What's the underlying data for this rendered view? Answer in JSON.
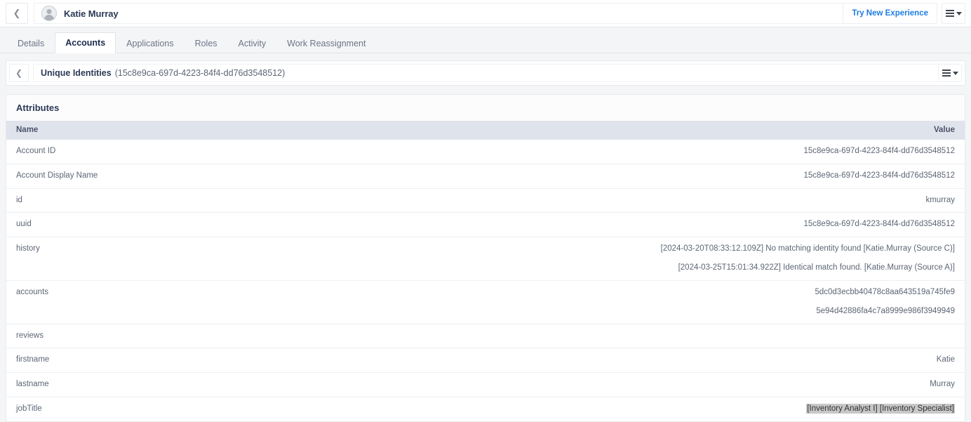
{
  "topbar": {
    "back_icon": "chevron-left-icon",
    "avatar_icon": "user-avatar-icon",
    "identity_name": "Katie Murray",
    "try_new_label": "Try New Experience",
    "menu_icon": "list-menu-icon"
  },
  "tabs": [
    {
      "label": "Details",
      "active": false
    },
    {
      "label": "Accounts",
      "active": true
    },
    {
      "label": "Applications",
      "active": false
    },
    {
      "label": "Roles",
      "active": false
    },
    {
      "label": "Activity",
      "active": false
    },
    {
      "label": "Work Reassignment",
      "active": false
    }
  ],
  "section": {
    "back_icon": "chevron-left-icon",
    "title": "Unique Identities",
    "subtitle": "(15c8e9ca-697d-4223-84f4-dd76d3548512)",
    "menu_icon": "list-menu-icon"
  },
  "attributes_card": {
    "title": "Attributes",
    "columns": {
      "name": "Name",
      "value": "Value"
    },
    "rows": [
      {
        "name": "Account ID",
        "values": [
          "15c8e9ca-697d-4223-84f4-dd76d3548512"
        ]
      },
      {
        "name": "Account Display Name",
        "values": [
          "15c8e9ca-697d-4223-84f4-dd76d3548512"
        ]
      },
      {
        "name": "id",
        "values": [
          "kmurray"
        ]
      },
      {
        "name": "uuid",
        "values": [
          "15c8e9ca-697d-4223-84f4-dd76d3548512"
        ]
      },
      {
        "name": "history",
        "values": [
          "[2024-03-20T08:33:12.109Z] No matching identity found [Katie.Murray (Source C)]",
          "[2024-03-25T15:01:34.922Z] Identical match found. [Katie.Murray (Source A)]"
        ]
      },
      {
        "name": "accounts",
        "values": [
          "5dc0d3ecbb40478c8aa643519a745fe9",
          "5e94d42886fa4c7a8999e986f3949949"
        ]
      },
      {
        "name": "reviews",
        "values": []
      },
      {
        "name": "firstname",
        "values": [
          "Katie"
        ]
      },
      {
        "name": "lastname",
        "values": [
          "Murray"
        ]
      },
      {
        "name": "jobTitle",
        "values": [
          "[Inventory Analyst I] [Inventory Specialist]"
        ],
        "highlighted": true
      }
    ]
  },
  "colors": {
    "accent_link": "#1f7de0",
    "header_row": "#dfe3ec",
    "page_bg": "#f4f5f7",
    "title_text": "#2b3a56",
    "selection_highlight": "#c8c8c8"
  }
}
